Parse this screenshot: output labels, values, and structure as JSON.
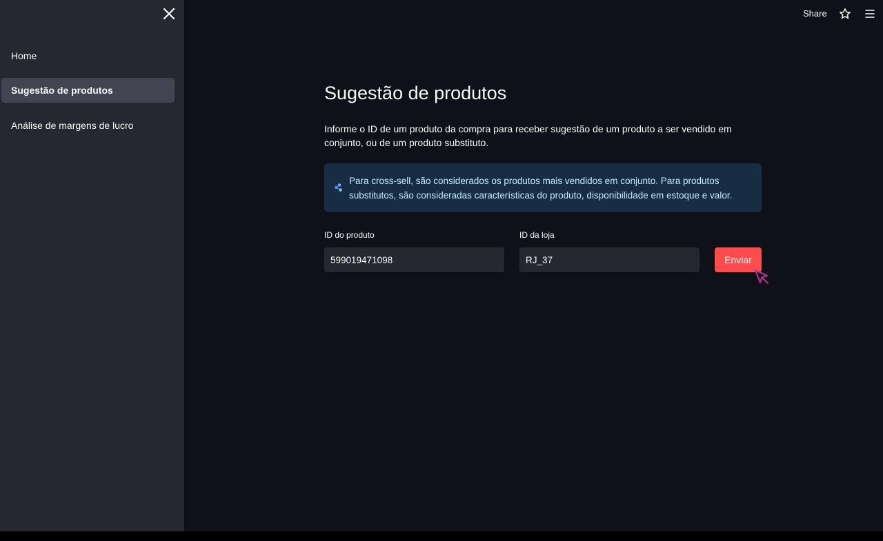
{
  "sidebar": {
    "items": [
      {
        "label": "Home",
        "active": false
      },
      {
        "label": "Sugestão de produtos",
        "active": true
      },
      {
        "label": "Análise de margens de lucro",
        "active": false
      }
    ]
  },
  "toolbar": {
    "share_label": "Share",
    "star_icon": "star-icon",
    "menu_icon": "hamburger-menu-icon"
  },
  "main": {
    "title": "Sugestão de produtos",
    "description": "Informe o ID de um produto da compra para receber sugestão de um produto a ser vendido em conjunto, ou de um produto substituto.",
    "info": {
      "icon": "molecule-icon",
      "text": "Para cross-sell, são considerados os produtos mais vendidos em conjunto. Para produtos substitutos, são consideradas características do produto, disponibilidade em estoque e valor."
    },
    "form": {
      "product_label": "ID do produto",
      "product_value": "599019471098",
      "store_label": "ID da loja",
      "store_value": "RJ_37",
      "submit_label": "Enviar"
    }
  },
  "colors": {
    "background": "#0e1117",
    "sidebar": "#262730",
    "active_item": "#434451",
    "info_bg": "#172d43",
    "info_text": "#c7ebff",
    "primary": "#ff4b4b",
    "cursor": "#b5328a"
  }
}
